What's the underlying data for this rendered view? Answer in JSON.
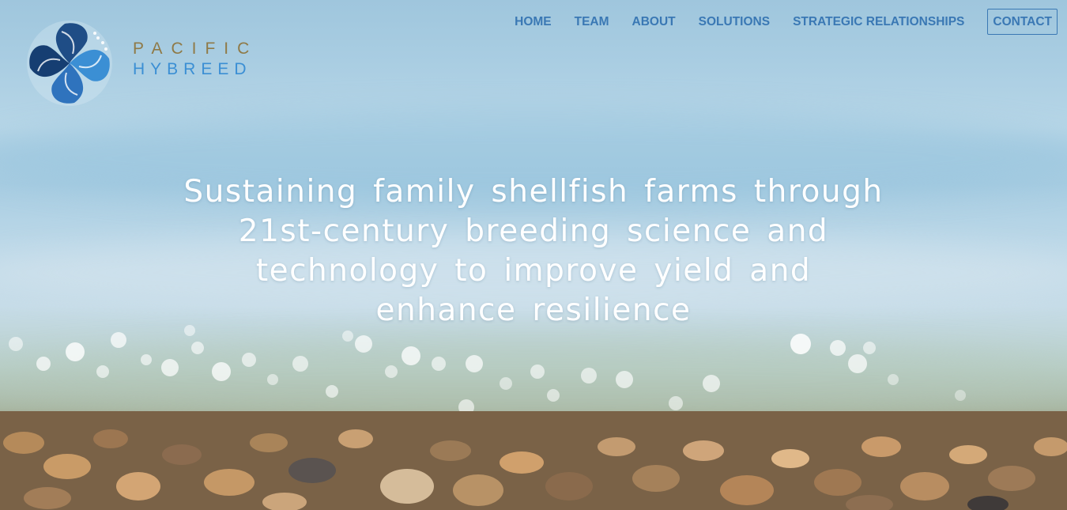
{
  "brand": {
    "name_line_1": "PACIFIC",
    "name_line_2": "HYBREED",
    "mark_icon": "shell-spiral-logo-icon",
    "colors": {
      "gold": "#8f7a47",
      "blue": "#3b8fd4",
      "navy": "#1f4d86"
    }
  },
  "nav": {
    "items": [
      {
        "label": "HOME"
      },
      {
        "label": "TEAM"
      },
      {
        "label": "ABOUT"
      },
      {
        "label": "SOLUTIONS"
      },
      {
        "label": "STRATEGIC RELATIONSHIPS"
      },
      {
        "label": "CONTACT"
      }
    ],
    "color": "#3a78b4"
  },
  "hero": {
    "headline": "Sustaining family shellfish farms through 21st-century breeding science and technology to improve yield and enhance resilience",
    "background": "blurred-beach-pebbles-and-sea"
  }
}
